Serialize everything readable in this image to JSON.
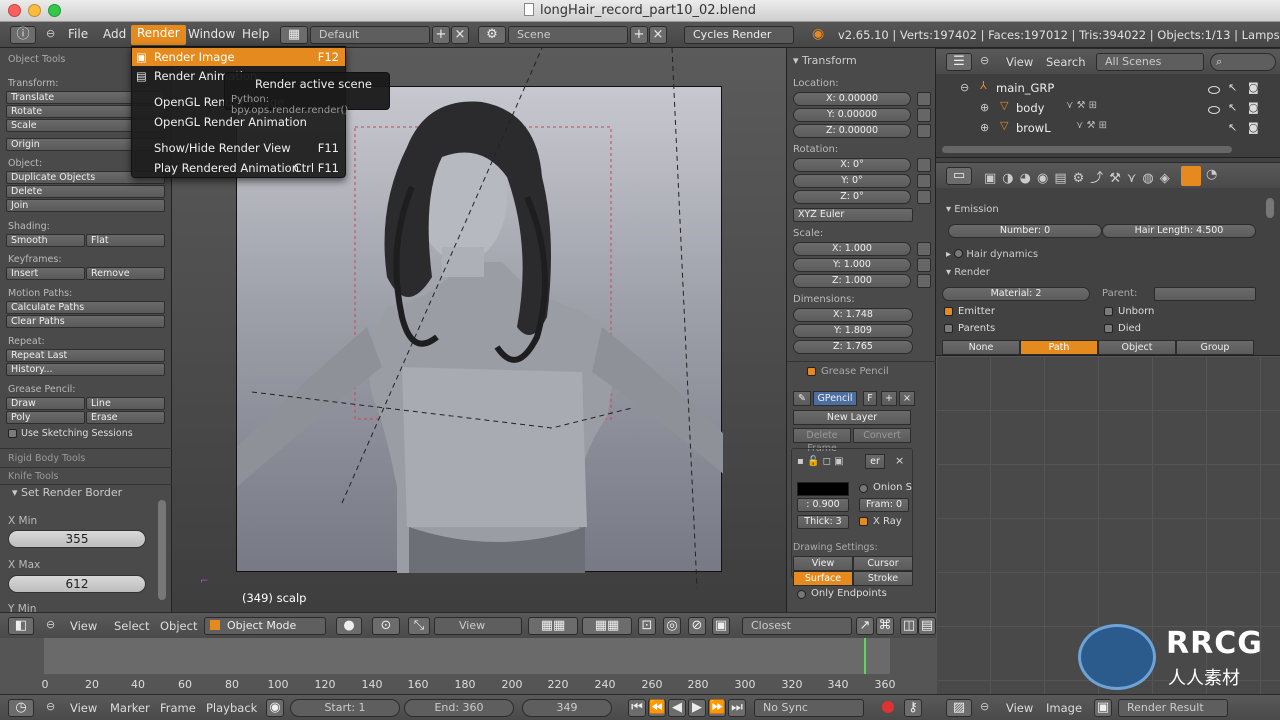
{
  "window": {
    "title": "longHair_record_part10_02.blend"
  },
  "topbar": {
    "menus": [
      "File",
      "Add",
      "Render",
      "Window",
      "Help"
    ],
    "layout": "Default",
    "scene": "Scene",
    "engine": "Cycles Render",
    "stats": "v2.65.10 | Verts:197402 | Faces:197012 | Tris:394022 | Objects:1/13 | Lamps:0/2 | Me"
  },
  "render_menu": {
    "items": [
      {
        "label": "Render Image",
        "shortcut": "F12"
      },
      {
        "label": "Render Animation",
        "shortcut": ""
      },
      {
        "label": "OpenGL Render Image",
        "shortcut": ""
      },
      {
        "label": "OpenGL Render Animation",
        "shortcut": ""
      },
      {
        "label": "Show/Hide Render View",
        "shortcut": "F11"
      },
      {
        "label": "Play Rendered Animation",
        "shortcut": "Ctrl F11"
      }
    ],
    "tooltip_title": "Render active scene",
    "tooltip_python": "Python: bpy.ops.render.render()"
  },
  "toolshelf": {
    "header": "Object Tools",
    "transform_label": "Transform:",
    "translate": "Translate",
    "rotate": "Rotate",
    "scale": "Scale",
    "origin": "Origin",
    "object_label": "Object:",
    "duplicate": "Duplicate Objects",
    "delete": "Delete",
    "join": "Join",
    "shading_label": "Shading:",
    "smooth": "Smooth",
    "flat": "Flat",
    "keyframes_label": "Keyframes:",
    "insert": "Insert",
    "remove": "Remove",
    "motion_label": "Motion Paths:",
    "calc_paths": "Calculate Paths",
    "clear_paths": "Clear Paths",
    "repeat_label": "Repeat:",
    "repeat_last": "Repeat Last",
    "history": "History...",
    "grease_label": "Grease Pencil:",
    "draw": "Draw",
    "line": "Line",
    "poly": "Poly",
    "erase": "Erase",
    "sketching": "Use Sketching Sessions",
    "rigid": "Rigid Body Tools",
    "knife": "Knife Tools",
    "border_title": "Set Render Border",
    "xmin_label": "X Min",
    "xmin": "355",
    "xmax_label": "X Max",
    "xmax": "612",
    "ymin_label": "Y Min"
  },
  "viewport": {
    "object_label": "(349) scalp",
    "header": {
      "view": "View",
      "select": "Select",
      "object": "Object",
      "mode": "Object Mode",
      "view2": "View",
      "snap": "Closest"
    }
  },
  "transform_panel": {
    "title": "Transform",
    "location_label": "Location:",
    "loc": [
      "X: 0.00000",
      "Y: 0.00000",
      "Z: 0.00000"
    ],
    "rotation_label": "Rotation:",
    "rot": [
      "X: 0°",
      "Y: 0°",
      "Z: 0°"
    ],
    "euler": "XYZ Euler",
    "scale_label": "Scale:",
    "scl": [
      "X: 1.000",
      "Y: 1.000",
      "Z: 1.000"
    ],
    "dim_label": "Dimensions:",
    "dim": [
      "X: 1.748",
      "Y: 1.809",
      "Z: 1.765"
    ],
    "grease_title": "Grease Pencil",
    "gpencil": "GPencil",
    "f": "F",
    "new_layer": "New Layer",
    "delete_frame": "Delete Frame",
    "convert": "Convert",
    "layer_name": "er",
    "opacity": ": 0.900",
    "onion": "Onion S",
    "frame": "Fram: 0",
    "thick": "Thick: 3",
    "xray": "X Ray",
    "drawing_settings": "Drawing Settings:",
    "view": "View",
    "cursor": "Cursor",
    "surface": "Surface",
    "stroke": "Stroke",
    "only_endpoints": "Only Endpoints"
  },
  "outliner": {
    "view": "View",
    "search": "Search",
    "scenes": "All Scenes",
    "rows": [
      "main_GRP",
      "body",
      "browL"
    ]
  },
  "particles": {
    "emission": "Emission",
    "number": "Number: 0",
    "hair_length": "Hair Length: 4.500",
    "hair_dynamics": "Hair dynamics",
    "render": "Render",
    "material": "Material: 2",
    "parent": "Parent:",
    "emitter": "Emitter",
    "unborn": "Unborn",
    "parents": "Parents",
    "died": "Died",
    "tabs": [
      "None",
      "Path",
      "Object",
      "Group"
    ]
  },
  "timeline": {
    "ticks": [
      "0",
      "20",
      "40",
      "60",
      "80",
      "100",
      "120",
      "140",
      "160",
      "180",
      "200",
      "220",
      "240",
      "260",
      "280",
      "300",
      "320",
      "340",
      "360"
    ],
    "view": "View",
    "marker": "Marker",
    "frame": "Frame",
    "playback": "Playback",
    "start": "Start: 1",
    "end": "End: 360",
    "current": "349",
    "sync": "No Sync"
  },
  "image_editor": {
    "view": "View",
    "image": "Image",
    "result": "Render Result"
  },
  "watermark": {
    "logo_text": "RRCG",
    "sub_text": "人人素材"
  },
  "colors": {
    "accent": "#e58a1e",
    "panel": "#4a4a4a",
    "header": "#555555"
  }
}
